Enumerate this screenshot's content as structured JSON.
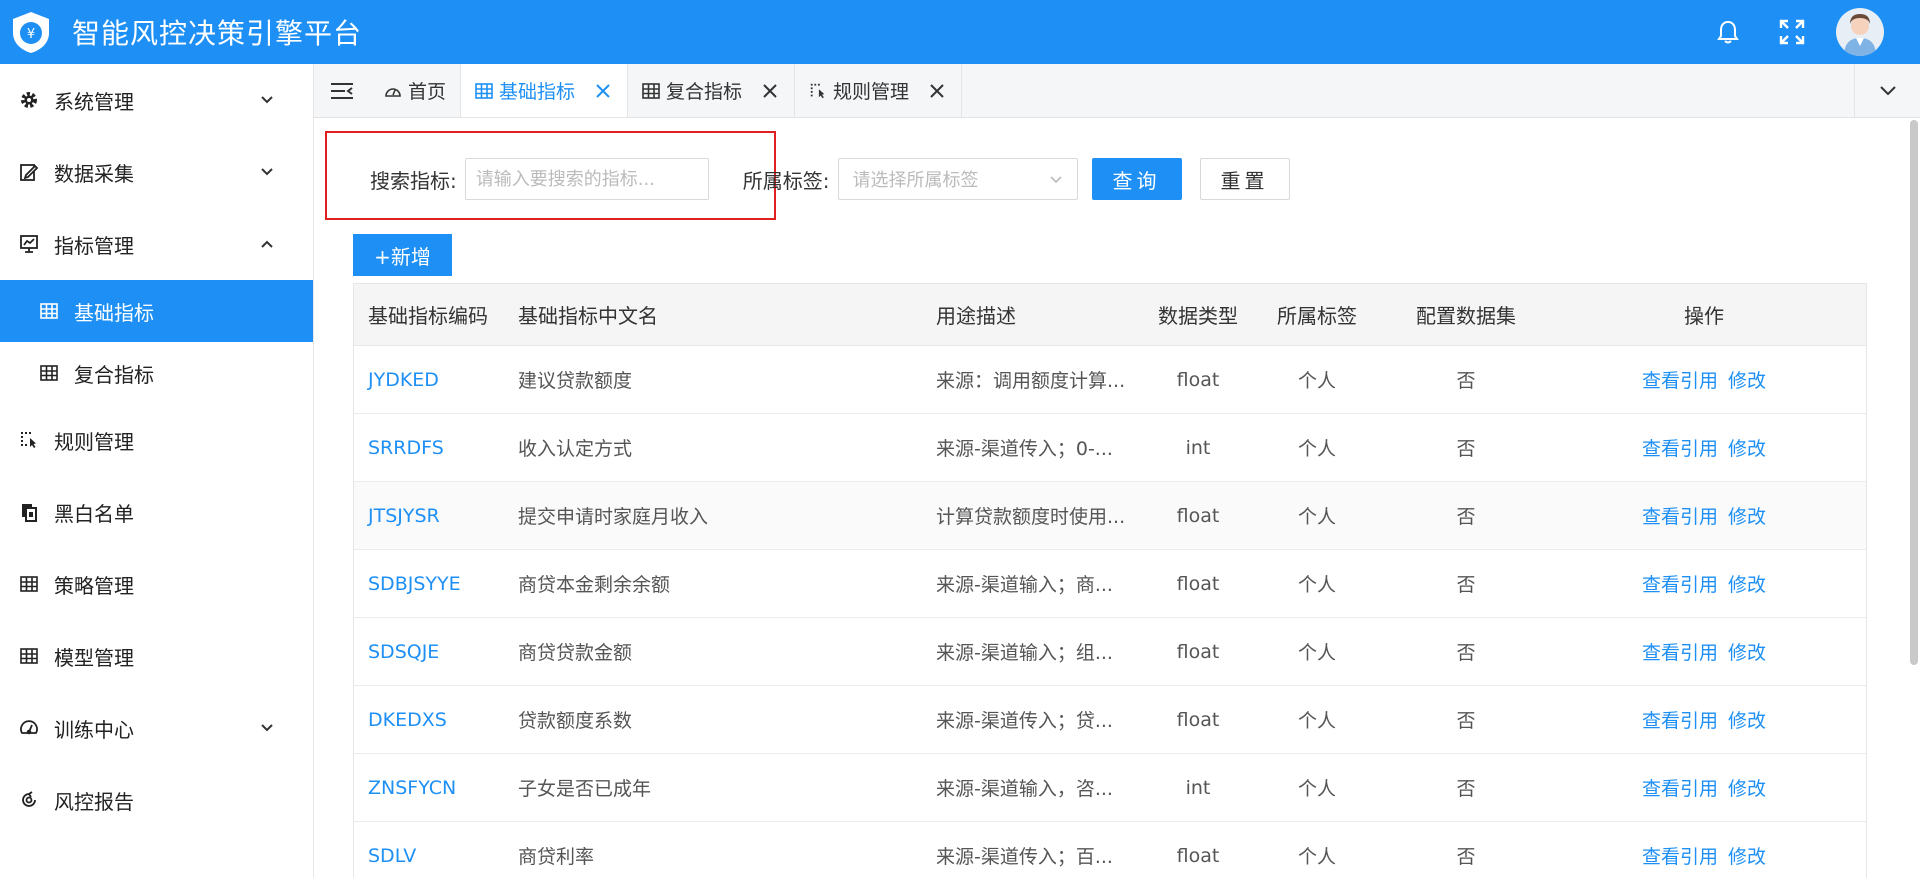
{
  "app": {
    "title": "智能风控决策引擎平台",
    "logo_symbol": "¥",
    "brand_color": "#1e90f5",
    "highlight_color": "#e02020"
  },
  "header": {
    "icons": [
      "bell-icon",
      "fullscreen-icon",
      "avatar"
    ]
  },
  "sidebar": {
    "items": [
      {
        "label": "系统管理",
        "icon": "gear-icon",
        "expandable": true
      },
      {
        "label": "数据采集",
        "icon": "edit-icon",
        "expandable": true
      },
      {
        "label": "指标管理",
        "icon": "monitor-chart-icon",
        "expandable": true,
        "expanded": true
      },
      {
        "label": "基础指标",
        "icon": "table-icon",
        "sub": true,
        "active": true
      },
      {
        "label": "复合指标",
        "icon": "table-icon",
        "sub": true
      },
      {
        "label": "规则管理",
        "icon": "rule-icon",
        "expandable": false
      },
      {
        "label": "黑白名单",
        "icon": "copy-icon",
        "expandable": false
      },
      {
        "label": "策略管理",
        "icon": "table-icon",
        "expandable": false
      },
      {
        "label": "模型管理",
        "icon": "table-icon",
        "expandable": false
      },
      {
        "label": "训练中心",
        "icon": "dashboard-icon",
        "expandable": true
      },
      {
        "label": "风控报告",
        "icon": "report-icon",
        "expandable": false
      }
    ]
  },
  "tabs": [
    {
      "label": "首页",
      "icon": "dashboard-icon",
      "closable": false,
      "active": false
    },
    {
      "label": "基础指标",
      "icon": "table-icon",
      "closable": true,
      "active": true
    },
    {
      "label": "复合指标",
      "icon": "table-icon",
      "closable": true,
      "active": false
    },
    {
      "label": "规则管理",
      "icon": "rule-icon",
      "closable": true,
      "active": false
    }
  ],
  "search": {
    "indicator_label": "搜索指标:",
    "indicator_placeholder": "请输入要搜索的指标...",
    "tag_label": "所属标签:",
    "tag_placeholder": "请选择所属标签",
    "query_button": "查询",
    "reset_button": "重置",
    "add_button": "+新增"
  },
  "table": {
    "headers": [
      "基础指标编码",
      "基础指标中文名",
      "用途描述",
      "数据类型",
      "所属标签",
      "配置数据集",
      "操作"
    ],
    "op_view": "查看引用",
    "op_edit": "修改",
    "rows": [
      {
        "code": "JYDKED",
        "name": "建议贷款额度",
        "desc": "来源：调用额度计算...",
        "type": "float",
        "tag": "个人",
        "dataset": "否"
      },
      {
        "code": "SRRDFS",
        "name": "收入认定方式",
        "desc": "来源-渠道传入；0-...",
        "type": "int",
        "tag": "个人",
        "dataset": "否"
      },
      {
        "code": "JTSJYSR",
        "name": "提交申请时家庭月收入",
        "desc": "计算贷款额度时使用...",
        "type": "float",
        "tag": "个人",
        "dataset": "否"
      },
      {
        "code": "SDBJSYYE",
        "name": "商贷本金剩余余额",
        "desc": "来源-渠道输入；商...",
        "type": "float",
        "tag": "个人",
        "dataset": "否"
      },
      {
        "code": "SDSQJE",
        "name": "商贷贷款金额",
        "desc": "来源-渠道输入；组...",
        "type": "float",
        "tag": "个人",
        "dataset": "否"
      },
      {
        "code": "DKEDXS",
        "name": "贷款额度系数",
        "desc": "来源-渠道传入；贷...",
        "type": "float",
        "tag": "个人",
        "dataset": "否"
      },
      {
        "code": "ZNSFYCN",
        "name": "子女是否已成年",
        "desc": "来源-渠道输入，咨...",
        "type": "int",
        "tag": "个人",
        "dataset": "否"
      },
      {
        "code": "SDLV",
        "name": "商贷利率",
        "desc": "来源-渠道传入；百...",
        "type": "float",
        "tag": "个人",
        "dataset": "否"
      }
    ]
  }
}
